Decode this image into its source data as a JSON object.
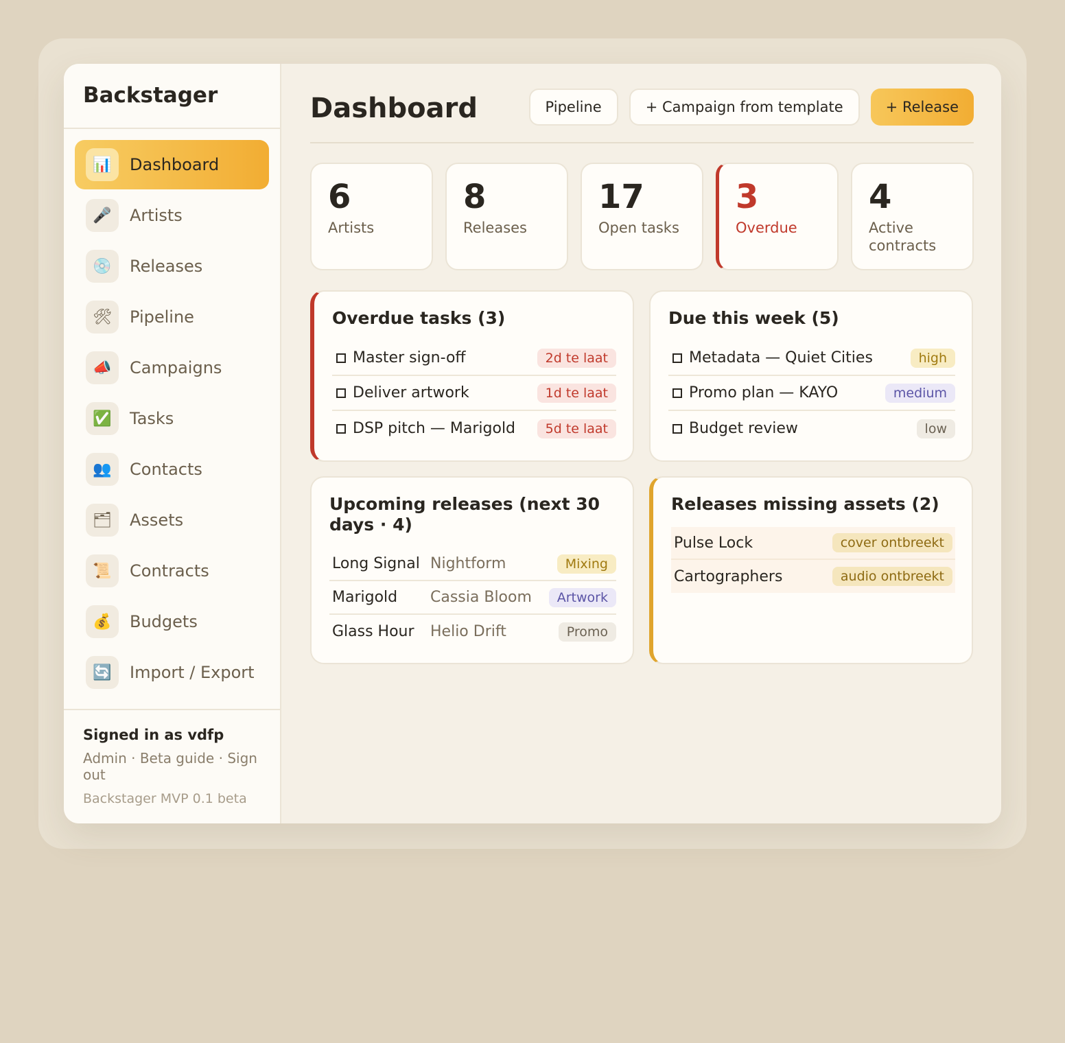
{
  "app": {
    "name": "Backstager"
  },
  "sidebar": {
    "items": [
      {
        "label": "Dashboard",
        "icon": "📊"
      },
      {
        "label": "Artists",
        "icon": "🎤"
      },
      {
        "label": "Releases",
        "icon": "💿"
      },
      {
        "label": "Pipeline",
        "icon": "🛠"
      },
      {
        "label": "Campaigns",
        "icon": "📣"
      },
      {
        "label": "Tasks",
        "icon": "✅"
      },
      {
        "label": "Contacts",
        "icon": "👥"
      },
      {
        "label": "Assets",
        "icon": "🗂"
      },
      {
        "label": "Contracts",
        "icon": "📜"
      },
      {
        "label": "Budgets",
        "icon": "💰"
      },
      {
        "label": "Import / Export",
        "icon": "🔄"
      }
    ],
    "footer": {
      "signed_in": "Signed in as vdfp",
      "admin": "Admin",
      "beta_guide": "Beta guide",
      "sign_out": "Sign out",
      "separator": " · ",
      "version": "Backstager MVP 0.1 beta"
    }
  },
  "header": {
    "title": "Dashboard",
    "pipeline_label": "Pipeline",
    "campaign_label": "+ Campaign from template",
    "release_label": "+ Release"
  },
  "stats": [
    {
      "value": "6",
      "label": "Artists"
    },
    {
      "value": "8",
      "label": "Releases"
    },
    {
      "value": "17",
      "label": "Open tasks"
    },
    {
      "value": "3",
      "label": "Overdue"
    },
    {
      "value": "4",
      "label": "Active contracts"
    }
  ],
  "overdue": {
    "title": "Overdue tasks (3)",
    "rows": [
      {
        "task": "Master sign-off",
        "late": "2d te laat"
      },
      {
        "task": "Deliver artwork",
        "late": "1d te laat"
      },
      {
        "task": "DSP pitch — Marigold",
        "late": "5d te laat"
      }
    ]
  },
  "due_week": {
    "title": "Due this week (5)",
    "rows": [
      {
        "task": "Metadata — Quiet Cities",
        "priority": "high"
      },
      {
        "task": "Promo plan — KAYO",
        "priority": "medium"
      },
      {
        "task": "Budget review",
        "priority": "low"
      }
    ]
  },
  "upcoming": {
    "title": "Upcoming releases (next 30 days · 4)",
    "rows": [
      {
        "title": "Long Signal",
        "artist": "Nightform",
        "stage": "Mixing"
      },
      {
        "title": "Marigold",
        "artist": "Cassia Bloom",
        "stage": "Artwork"
      },
      {
        "title": "Glass Hour",
        "artist": "Helio Drift",
        "stage": "Promo"
      }
    ]
  },
  "missing": {
    "title": "Releases missing assets (2)",
    "rows": [
      {
        "title": "Pulse Lock",
        "missing": "cover ontbreekt"
      },
      {
        "title": "Cartographers",
        "missing": "audio ontbreekt"
      }
    ]
  },
  "colors": {
    "accent": "#f2ad33",
    "danger": "#c0392b",
    "background": "#dfd4c0"
  }
}
